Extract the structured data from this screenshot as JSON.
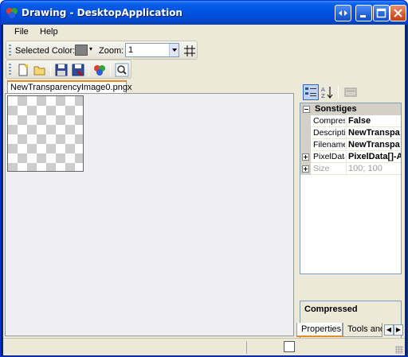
{
  "window": {
    "title": "Drawing - DesktopApplication"
  },
  "menu": {
    "items": [
      "File",
      "Help"
    ]
  },
  "toolbar": {
    "selected_color_label": "Selected Color:",
    "selected_color": "#808080",
    "zoom_label": "Zoom:",
    "zoom_value": "1"
  },
  "document": {
    "tab_label": "NewTransparencyImage0.pngx"
  },
  "properties": {
    "category": "Sonstiges",
    "rows": [
      {
        "name": "Compressed",
        "value": "False",
        "expandable": false,
        "enabled": true
      },
      {
        "name": "Description",
        "value": "NewTranspa",
        "expandable": false,
        "enabled": true
      },
      {
        "name": "Filename",
        "value": "NewTranspa",
        "expandable": false,
        "enabled": true
      },
      {
        "name": "PixelData",
        "value": "PixelData[]-A",
        "expandable": true,
        "enabled": true
      },
      {
        "name": "Size",
        "value": "100; 100",
        "expandable": true,
        "enabled": false
      }
    ],
    "description_title": "Compressed"
  },
  "panel_tabs": {
    "properties": "Properties",
    "tools": "Tools and"
  },
  "colors": {
    "titlebar": "#0054e3",
    "client": "#ece9d8",
    "tab_accent": "#e68b2c"
  }
}
